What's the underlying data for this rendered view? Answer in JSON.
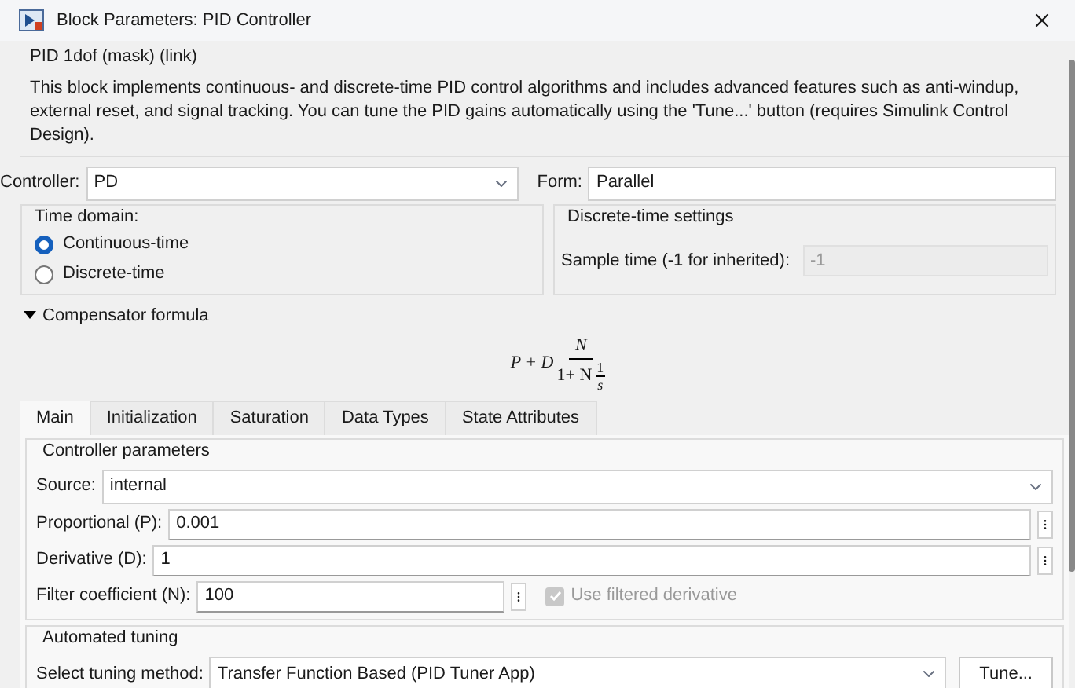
{
  "window": {
    "title": "Block Parameters: PID Controller"
  },
  "header": {
    "title": "PID 1dof (mask) (link)",
    "description": "This block implements continuous- and discrete-time PID control algorithms and includes advanced features such as anti-windup, external reset, and signal tracking. You can tune the PID gains automatically using the 'Tune...' button (requires Simulink Control Design)."
  },
  "controller": {
    "label": "Controller:",
    "value": "PD"
  },
  "form": {
    "label": "Form:",
    "value": "Parallel"
  },
  "time_domain": {
    "title": "Time domain:",
    "options": [
      {
        "label": "Continuous-time",
        "selected": true
      },
      {
        "label": "Discrete-time",
        "selected": false
      }
    ]
  },
  "discrete_settings": {
    "title": "Discrete-time settings",
    "label": "Sample time (-1 for inherited):",
    "value": "-1",
    "disabled": true
  },
  "compensator": {
    "label": "Compensator formula",
    "expanded": true,
    "formula": {
      "lead": "P + D",
      "numerator": "N",
      "denominator": "1+ N",
      "inner_numerator": "1",
      "inner_denominator": "s"
    }
  },
  "tabs": [
    {
      "label": "Main",
      "selected": true
    },
    {
      "label": "Initialization",
      "selected": false
    },
    {
      "label": "Saturation",
      "selected": false
    },
    {
      "label": "Data Types",
      "selected": false
    },
    {
      "label": "State Attributes",
      "selected": false
    }
  ],
  "controller_parameters": {
    "title": "Controller parameters",
    "source": {
      "label": "Source:",
      "value": "internal"
    },
    "fields": [
      {
        "label": "Proportional (P):",
        "value": "0.001"
      },
      {
        "label": "Derivative (D):",
        "value": "1"
      }
    ],
    "filter": {
      "label": "Filter coefficient (N):",
      "value": "100"
    },
    "use_filtered": {
      "label": "Use filtered derivative",
      "checked": true,
      "disabled": true
    }
  },
  "automated_tuning": {
    "title": "Automated tuning",
    "label": "Select tuning method:",
    "value": "Transfer Function Based (PID Tuner App)",
    "button": "Tune..."
  }
}
